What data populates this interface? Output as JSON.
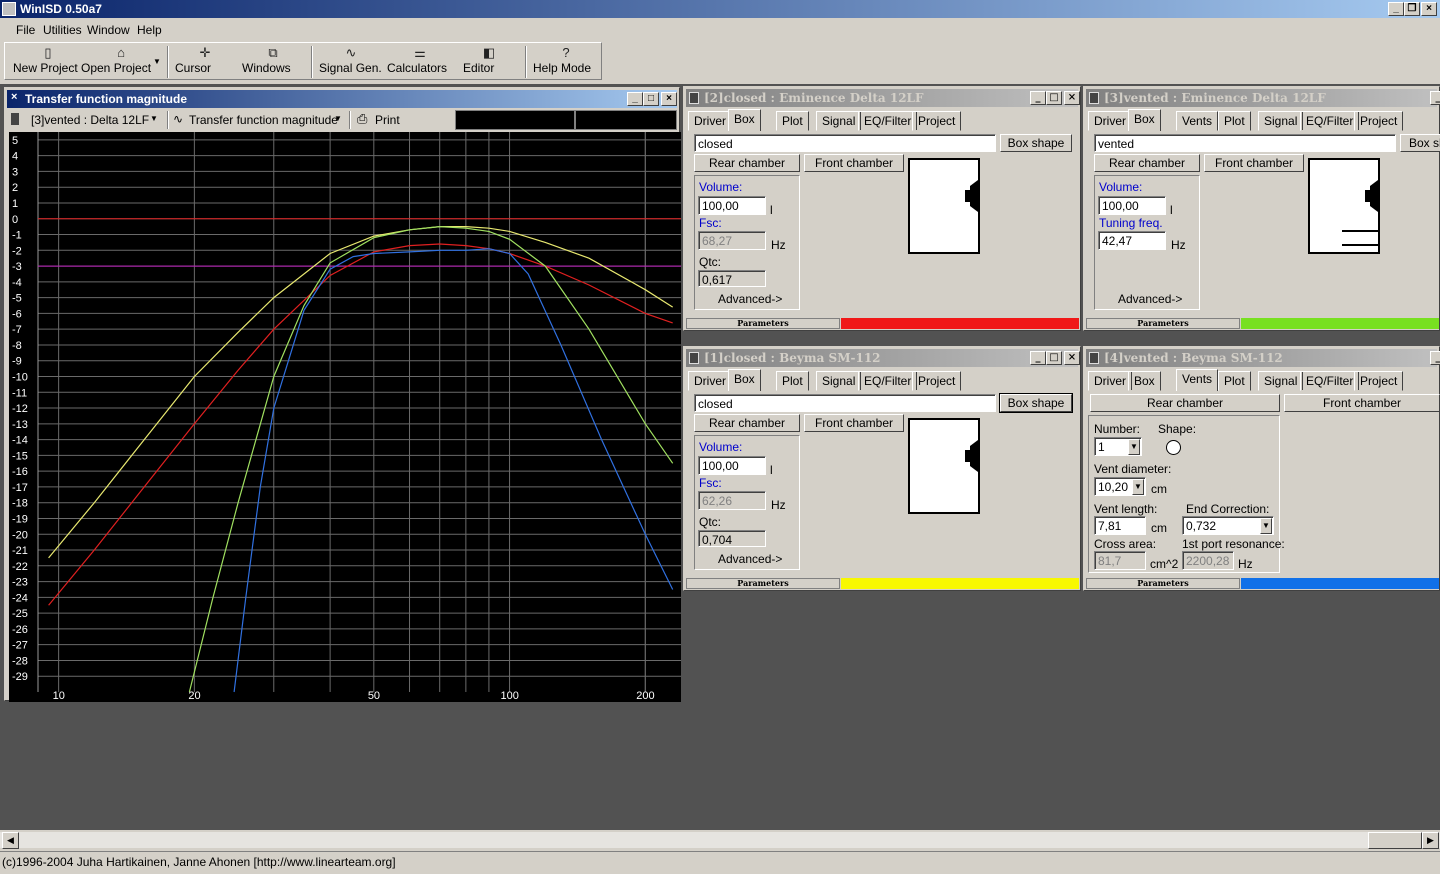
{
  "app": {
    "title": "WinISD 0.50a7"
  },
  "menu": [
    "File",
    "Utilities",
    "Window",
    "Help"
  ],
  "toolbar": {
    "new_project": "New Project",
    "open_project": "Open Project",
    "cursor": "Cursor",
    "windows": "Windows",
    "signal_gen": "Signal Gen.",
    "calculators": "Calculators",
    "editor": "Editor",
    "help_mode": "Help Mode"
  },
  "graph": {
    "title": "Transfer function magnitude",
    "project_select": "[3]vented : Delta 12LF",
    "plot_select": "Transfer function magnitude",
    "print": "Print"
  },
  "chart_data": {
    "type": "line",
    "title": "",
    "xlabel": "",
    "ylabel": "",
    "x_scale": "log",
    "xlim": [
      9,
      240
    ],
    "ylim": [
      -30,
      5.5
    ],
    "x_tick_labels": [
      "10",
      "20",
      "50",
      "100",
      "200"
    ],
    "y_tick_labels": [
      "5",
      "4",
      "3",
      "2",
      "1",
      "0",
      "-1",
      "-2",
      "-3",
      "-4",
      "-5",
      "-6",
      "-7",
      "-8",
      "-9",
      "-10",
      "-11",
      "-12",
      "-13",
      "-14",
      "-15",
      "-16",
      "-17",
      "-18",
      "-19",
      "-20",
      "-21",
      "-22",
      "-23",
      "-24",
      "-25",
      "-26",
      "-27",
      "-28",
      "-29"
    ],
    "grid": true,
    "reference_lines": [
      {
        "y": 0,
        "color": "#e02020"
      },
      {
        "y": -3,
        "color": "#c020c0"
      }
    ],
    "series": [
      {
        "color": "#e8e870",
        "x": [
          9.5,
          12,
          15,
          20,
          25,
          30,
          40,
          50,
          60,
          70,
          80,
          90,
          100,
          120,
          150,
          200,
          230
        ],
        "y": [
          -21.5,
          -18,
          -14.5,
          -10,
          -7.2,
          -5,
          -2.2,
          -1.1,
          -0.7,
          -0.5,
          -0.5,
          -0.6,
          -0.8,
          -1.5,
          -2.5,
          -4.5,
          -5.6
        ]
      },
      {
        "color": "#e02020",
        "x": [
          9.5,
          12,
          15,
          20,
          25,
          30,
          40,
          50,
          60,
          70,
          80,
          90,
          100,
          120,
          150,
          200,
          230
        ],
        "y": [
          -24.5,
          -21,
          -17.5,
          -13,
          -9.6,
          -7,
          -3.6,
          -2.1,
          -1.7,
          -1.6,
          -1.7,
          -1.9,
          -2.2,
          -3,
          -4.2,
          -6,
          -6.6
        ]
      },
      {
        "color": "#a0e060",
        "x": [
          19.5,
          22,
          25,
          30,
          35,
          40,
          50,
          60,
          70,
          80,
          90,
          100,
          120,
          150,
          200,
          230
        ],
        "y": [
          -30,
          -24,
          -18,
          -10,
          -5.5,
          -2.8,
          -1.2,
          -0.7,
          -0.5,
          -0.6,
          -0.8,
          -1.3,
          -3,
          -7,
          -13,
          -15.5
        ]
      },
      {
        "color": "#3070e0",
        "x": [
          24.5,
          26,
          28,
          30,
          35,
          40,
          45,
          50,
          60,
          70,
          80,
          90,
          100,
          110,
          130,
          160,
          200,
          230
        ],
        "y": [
          -30,
          -24,
          -17,
          -12,
          -5.8,
          -3.2,
          -2.4,
          -2.2,
          -2.1,
          -2.0,
          -2.0,
          -1.9,
          -2.2,
          -3.5,
          -8,
          -14,
          -20,
          -23.5
        ]
      }
    ]
  },
  "windows": {
    "w2": {
      "title": "[2]closed : Eminence Delta 12LF",
      "tabs": [
        "Driver",
        "Box",
        "Plot",
        "Signal",
        "EQ/Filter",
        "Project"
      ],
      "name": "closed",
      "box_shape": "Box shape",
      "rear": "Rear chamber",
      "front": "Front chamber",
      "volume_label": "Volume:",
      "volume": "100,00",
      "volume_unit": "l",
      "fsc_label": "Fsc:",
      "fsc": "68,27",
      "fsc_unit": "Hz",
      "qtc_label": "Qtc:",
      "qtc": "0,617",
      "advanced": "Advanced->",
      "params": "Parameters",
      "color": "#f01818"
    },
    "w3": {
      "title": "[3]vented : Eminence Delta 12LF",
      "tabs": [
        "Driver",
        "Box",
        "Vents",
        "Plot",
        "Signal",
        "EQ/Filter",
        "Project"
      ],
      "name": "vented",
      "box_shape": "Box sh",
      "rear": "Rear chamber",
      "front": "Front chamber",
      "volume_label": "Volume:",
      "volume": "100,00",
      "volume_unit": "l",
      "tuning_label": "Tuning freq.",
      "tuning": "42,47",
      "tuning_unit": "Hz",
      "advanced": "Advanced->",
      "params": "Parameters",
      "color": "#78e020"
    },
    "w1": {
      "title": "[1]closed : Beyma SM-112",
      "tabs": [
        "Driver",
        "Box",
        "Plot",
        "Signal",
        "EQ/Filter",
        "Project"
      ],
      "name": "closed",
      "box_shape": "Box shape",
      "rear": "Rear chamber",
      "front": "Front chamber",
      "volume_label": "Volume:",
      "volume": "100,00",
      "volume_unit": "l",
      "fsc_label": "Fsc:",
      "fsc": "62,26",
      "fsc_unit": "Hz",
      "qtc_label": "Qtc:",
      "qtc": "0,704",
      "advanced": "Advanced->",
      "params": "Parameters",
      "color": "#f8f800"
    },
    "w4": {
      "title": "[4]vented : Beyma SM-112",
      "tabs": [
        "Driver",
        "Box",
        "Vents",
        "Plot",
        "Signal",
        "EQ/Filter",
        "Project"
      ],
      "rear": "Rear chamber",
      "front": "Front chamber",
      "number_label": "Number:",
      "number": "1",
      "shape_label": "Shape:",
      "vent_diam_label": "Vent diameter:",
      "vent_diam": "10,20",
      "vent_diam_unit": "cm",
      "vent_len_label": "Vent length:",
      "vent_len": "7,81",
      "vent_len_unit": "cm",
      "end_corr_label": "End Correction:",
      "end_corr": "0,732",
      "cross_label": "Cross area:",
      "cross": "81,7",
      "cross_unit": "cm^2",
      "port_res_label": "1st port resonance:",
      "port_res": "2200,28",
      "port_res_unit": "Hz",
      "params": "Parameters",
      "color": "#1070e8"
    }
  },
  "statusbar": "(c)1996-2004 Juha Hartikainen, Janne Ahonen [http://www.linearteam.org]"
}
